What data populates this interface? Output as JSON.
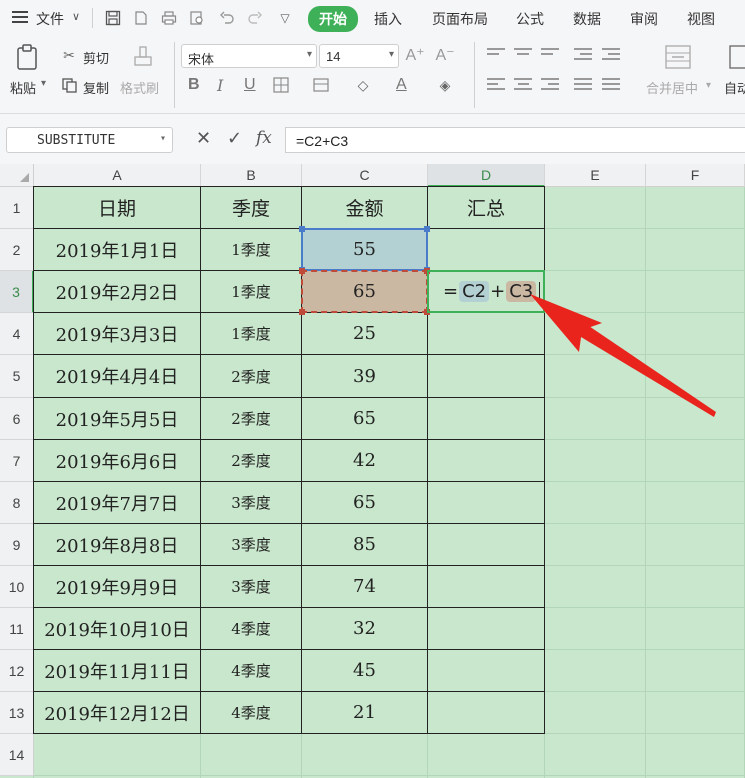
{
  "menubar": {
    "file": "文件",
    "tabs": [
      {
        "label": "开始",
        "active": true
      },
      {
        "label": "插入"
      },
      {
        "label": "页面布局"
      },
      {
        "label": "公式"
      },
      {
        "label": "数据"
      },
      {
        "label": "审阅"
      },
      {
        "label": "视图"
      }
    ]
  },
  "ribbon": {
    "paste": "粘贴",
    "cut": "剪切",
    "copy": "复制",
    "format_painter": "格式刷",
    "font_name": "宋体",
    "font_size": "14",
    "merge_center": "合并居中",
    "auto_wrap": "自动"
  },
  "formula_bar": {
    "name_box": "SUBSTITUTE",
    "fx": "fx",
    "formula": "=C2+C3"
  },
  "sheet": {
    "columns": [
      "A",
      "B",
      "C",
      "D",
      "E",
      "F"
    ],
    "rows": [
      "1",
      "2",
      "3",
      "4",
      "5",
      "6",
      "7",
      "8",
      "9",
      "10",
      "11",
      "12",
      "13",
      "14"
    ],
    "header": [
      "日期",
      "季度",
      "金额",
      "汇总"
    ],
    "data": [
      [
        "2019年1月1日",
        "1季度",
        "55"
      ],
      [
        "2019年2月2日",
        "1季度",
        "65"
      ],
      [
        "2019年3月3日",
        "1季度",
        "25"
      ],
      [
        "2019年4月4日",
        "2季度",
        "39"
      ],
      [
        "2019年5月5日",
        "2季度",
        "65"
      ],
      [
        "2019年6月6日",
        "2季度",
        "42"
      ],
      [
        "2019年7月7日",
        "3季度",
        "65"
      ],
      [
        "2019年8月8日",
        "3季度",
        "85"
      ],
      [
        "2019年9月9日",
        "3季度",
        "74"
      ],
      [
        "2019年10月10日",
        "4季度",
        "32"
      ],
      [
        "2019年11月11日",
        "4季度",
        "45"
      ],
      [
        "2019年12月12日",
        "4季度",
        "21"
      ]
    ],
    "editing": {
      "eq": "=",
      "ref1": "C2",
      "op": "+",
      "ref2": "C3"
    }
  },
  "colors": {
    "accent": "#3db058",
    "sheet_bg": "#c8e7cc",
    "ref_c2": "#b3d0d2",
    "ref_c3": "#cbb8a3",
    "arrow": "#e8241c"
  }
}
